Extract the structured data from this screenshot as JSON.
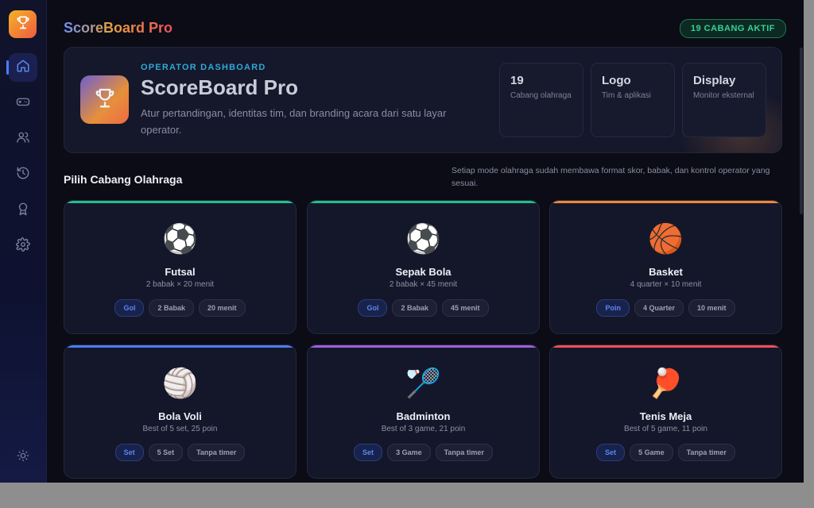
{
  "header": {
    "brand": "ScoreBoard Pro",
    "active_badge": "19 CABANG AKTIF"
  },
  "sidebar": {
    "logo_icon": "trophy-icon",
    "items": [
      {
        "icon": "home-icon",
        "active": true
      },
      {
        "icon": "gamepad-icon",
        "active": false
      },
      {
        "icon": "users-icon",
        "active": false
      },
      {
        "icon": "history-icon",
        "active": false
      },
      {
        "icon": "award-icon",
        "active": false
      },
      {
        "icon": "gear-icon",
        "active": false
      }
    ],
    "theme_icon": "sun-icon"
  },
  "hero": {
    "eyebrow": "OPERATOR DASHBOARD",
    "title": "ScoreBoard Pro",
    "description": "Atur pertandingan, identitas tim, dan branding acara dari satu layar operator.",
    "stats": [
      {
        "value": "19",
        "label": "Cabang olahraga"
      },
      {
        "value": "Logo",
        "label": "Tim & aplikasi"
      },
      {
        "value": "Display",
        "label": "Monitor eksternal"
      }
    ]
  },
  "section": {
    "title": "Pilih Cabang Olahraga",
    "note": "Setiap mode olahraga sudah membawa format skor, babak, dan kontrol operator yang sesuai."
  },
  "sports": [
    {
      "name": "Futsal",
      "emoji": "⚽",
      "format": "2 babak × 20 menit",
      "accent": "#22c08a",
      "chips": [
        "Gol",
        "2 Babak",
        "20 menit"
      ]
    },
    {
      "name": "Sepak Bola",
      "emoji": "⚽",
      "format": "2 babak × 45 menit",
      "accent": "#22c08a",
      "chips": [
        "Gol",
        "2 Babak",
        "45 menit"
      ]
    },
    {
      "name": "Basket",
      "emoji": "🏀",
      "format": "4 quarter × 10 menit",
      "accent": "#f0883a",
      "chips": [
        "Poin",
        "4 Quarter",
        "10 menit"
      ]
    },
    {
      "name": "Bola Voli",
      "emoji": "🏐",
      "format": "Best of 5 set, 25 poin",
      "accent": "#4d7cf0",
      "chips": [
        "Set",
        "5 Set",
        "Tanpa timer"
      ]
    },
    {
      "name": "Badminton",
      "emoji": "🏸",
      "format": "Best of 3 game, 21 poin",
      "accent": "#9f5fe0",
      "chips": [
        "Set",
        "3 Game",
        "Tanpa timer"
      ]
    },
    {
      "name": "Tenis Meja",
      "emoji": "🏓",
      "format": "Best of 5 game, 11 poin",
      "accent": "#ef4f5b",
      "chips": [
        "Set",
        "5 Game",
        "Tanpa timer"
      ]
    }
  ]
}
